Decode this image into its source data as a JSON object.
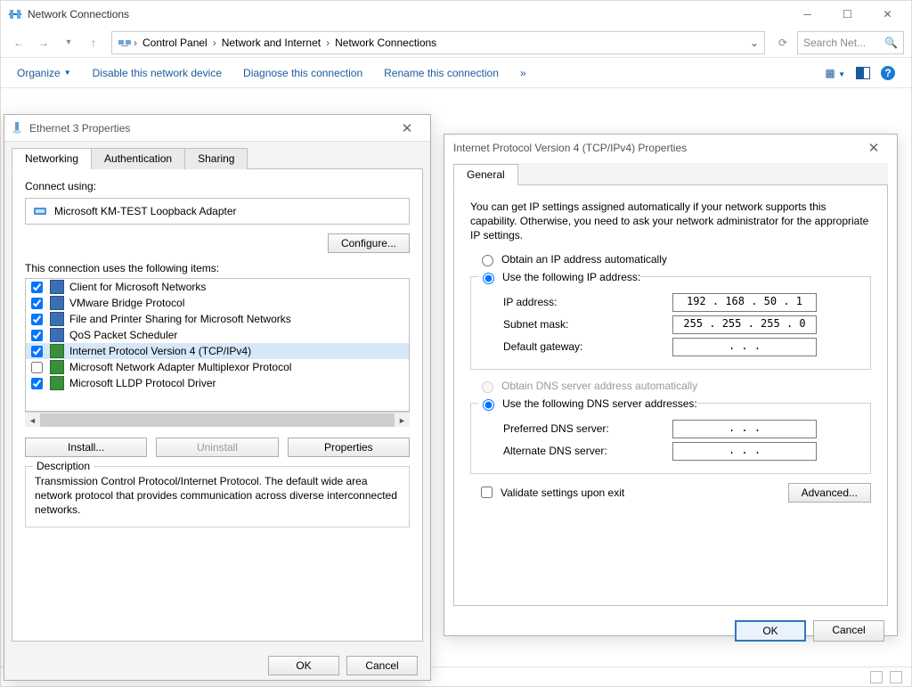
{
  "explorer": {
    "title": "Network Connections",
    "breadcrumbs": [
      "Control Panel",
      "Network and Internet",
      "Network Connections"
    ],
    "search_placeholder": "Search Net...",
    "commands": {
      "organize": "Organize",
      "disable": "Disable this network device",
      "diagnose": "Diagnose this connection",
      "rename": "Rename this connection",
      "more": "»"
    }
  },
  "eth": {
    "win_title": "Ethernet 3 Properties",
    "tabs": [
      "Networking",
      "Authentication",
      "Sharing"
    ],
    "connect_using_label": "Connect using:",
    "adapter": "Microsoft KM-TEST Loopback Adapter",
    "configure": "Configure...",
    "items_label": "This connection uses the following items:",
    "items": [
      {
        "checked": true,
        "color": "blue",
        "label": "Client for Microsoft Networks"
      },
      {
        "checked": true,
        "color": "blue",
        "label": "VMware Bridge Protocol"
      },
      {
        "checked": true,
        "color": "blue",
        "label": "File and Printer Sharing for Microsoft Networks"
      },
      {
        "checked": true,
        "color": "blue",
        "label": "QoS Packet Scheduler"
      },
      {
        "checked": true,
        "color": "green",
        "label": "Internet Protocol Version 4 (TCP/IPv4)",
        "selected": true
      },
      {
        "checked": false,
        "color": "green",
        "label": "Microsoft Network Adapter Multiplexor Protocol"
      },
      {
        "checked": true,
        "color": "green",
        "label": "Microsoft LLDP Protocol Driver"
      }
    ],
    "install": "Install...",
    "uninstall": "Uninstall",
    "props": "Properties",
    "desc_title": "Description",
    "desc": "Transmission Control Protocol/Internet Protocol. The default wide area network protocol that provides communication across diverse interconnected networks.",
    "ok": "OK",
    "cancel": "Cancel"
  },
  "ipv4": {
    "win_title": "Internet Protocol Version 4 (TCP/IPv4) Properties",
    "tab": "General",
    "blurb": "You can get IP settings assigned automatically if your network supports this capability. Otherwise, you need to ask your network administrator for the appropriate IP settings.",
    "r_auto_ip": "Obtain an IP address automatically",
    "r_static_ip": "Use the following IP address:",
    "ip_label": "IP address:",
    "mask_label": "Subnet mask:",
    "gw_label": "Default gateway:",
    "ip": "192 . 168 .  50  .  1",
    "mask": "255 . 255 . 255 .  0",
    "gw": ".        .        .",
    "r_auto_dns": "Obtain DNS server address automatically",
    "r_static_dns": "Use the following DNS server addresses:",
    "dns1_label": "Preferred DNS server:",
    "dns2_label": "Alternate DNS server:",
    "dns1": ".        .        .",
    "dns2": ".        .        .",
    "validate": "Validate settings upon exit",
    "advanced": "Advanced...",
    "ok": "OK",
    "cancel": "Cancel"
  }
}
